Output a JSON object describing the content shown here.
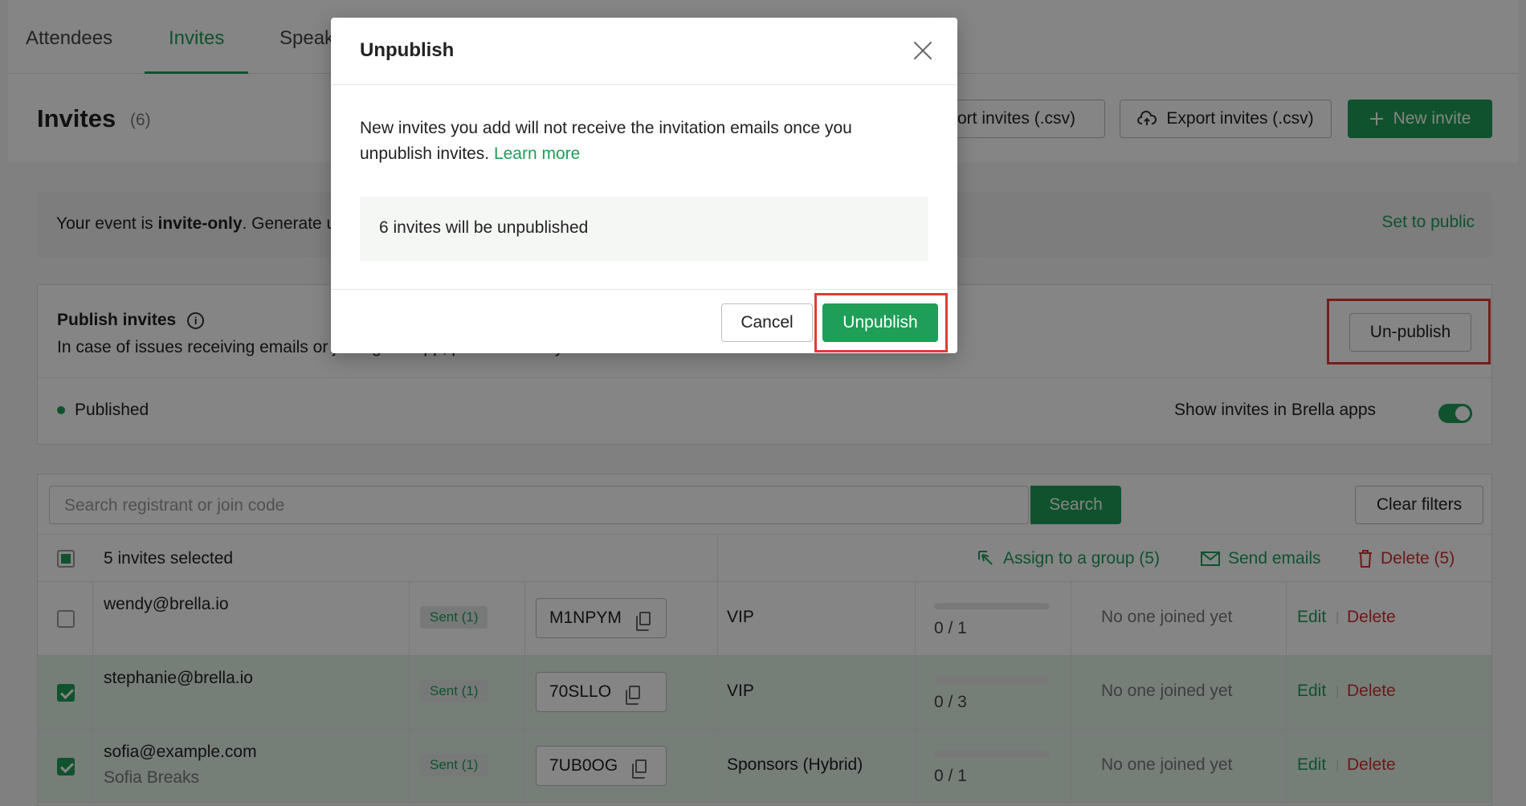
{
  "tabs": [
    "Attendees",
    "Invites",
    "Speakers"
  ],
  "header": {
    "title": "Invites",
    "count": "(6)",
    "import_label": "Import invites (.csv)",
    "export_label": "Export invites (.csv)",
    "new_invite_label": "New invite"
  },
  "notice": {
    "text_prefix": "Your event is ",
    "text_bold": "invite-only",
    "text_suffix": ". Generate unique join codes for attendees.",
    "set_public_label": "Set to public"
  },
  "publish": {
    "title": "Publish invites",
    "description": "In case of issues receiving emails or joining the app, please check your invites.",
    "status": "Published",
    "unpublish_label": "Un-publish",
    "show_invites_label": "Show invites in Brella apps"
  },
  "table": {
    "search_placeholder": "Search registrant or join code",
    "search_label": "Search",
    "clear_filters_label": "Clear filters",
    "selected_label": "5 invites selected",
    "assign_label": "Assign to a group (5)",
    "send_emails_label": "Send emails",
    "delete_bulk_label": "Delete (5)",
    "rows": [
      {
        "email": "wendy@brella.io",
        "name": "",
        "status": "Sent (1)",
        "code": "M1NPYM",
        "group": "VIP",
        "count": "0 / 1",
        "joined": "No one joined yet",
        "edit": "Edit",
        "delete": "Delete",
        "selected": false
      },
      {
        "email": "stephanie@brella.io",
        "name": "",
        "status": "Sent (1)",
        "code": "70SLLO",
        "group": "VIP",
        "count": "0 / 3",
        "joined": "No one joined yet",
        "edit": "Edit",
        "delete": "Delete",
        "selected": true
      },
      {
        "email": "sofia@example.com",
        "name": "Sofia Breaks",
        "status": "Sent (1)",
        "code": "7UB0OG",
        "group": "Sponsors (Hybrid)",
        "count": "0 / 1",
        "joined": "No one joined yet",
        "edit": "Edit",
        "delete": "Delete",
        "selected": true
      }
    ]
  },
  "modal": {
    "title": "Unpublish",
    "body": "New invites you add will not receive the invitation emails once you unpublish invites.",
    "learn_more": "Learn more",
    "info": "6 invites will be unpublished",
    "cancel_label": "Cancel",
    "confirm_label": "Unpublish"
  },
  "colors": {
    "accent": "#1e9e56",
    "danger": "#d32f2f",
    "highlight": "#e53935"
  },
  "icons": [
    "info-icon",
    "copy-icon",
    "close-icon",
    "plus-icon",
    "cloud-upload-icon",
    "cursor-icon",
    "mail-icon",
    "trash-icon"
  ]
}
